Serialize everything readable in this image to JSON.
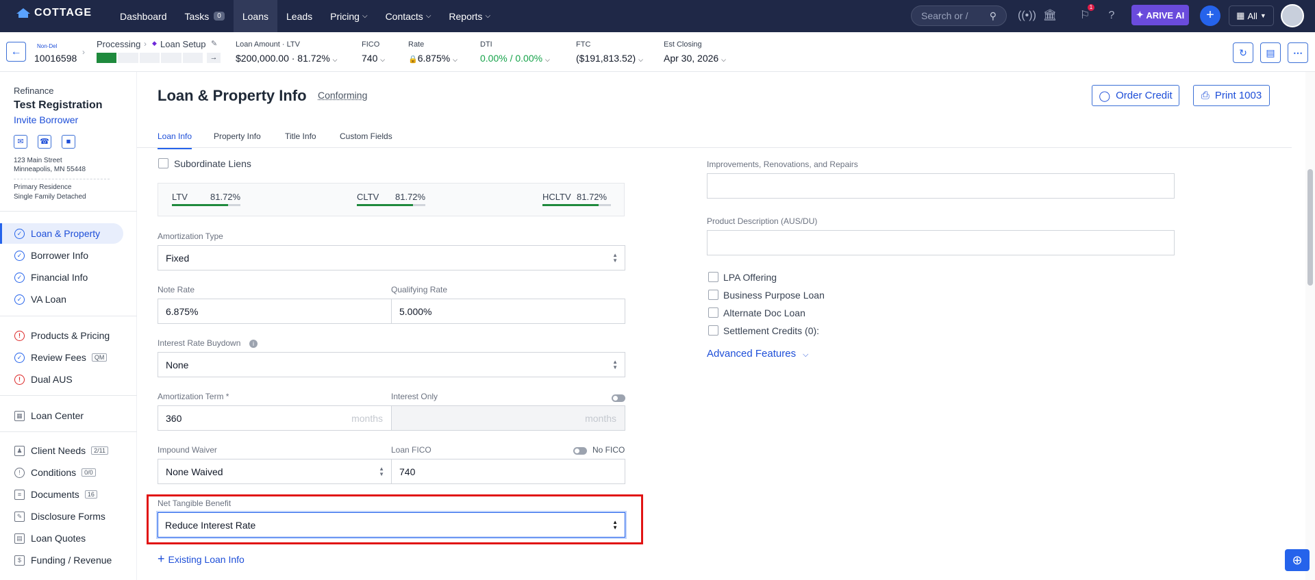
{
  "brand": "COTTAGE",
  "nav": {
    "items": [
      {
        "label": "Dashboard"
      },
      {
        "label": "Tasks",
        "badge": "0"
      },
      {
        "label": "Loans",
        "active": true
      },
      {
        "label": "Leads"
      },
      {
        "label": "Pricing",
        "dropdown": true
      },
      {
        "label": "Contacts",
        "dropdown": true
      },
      {
        "label": "Reports",
        "dropdown": true
      }
    ],
    "search_placeholder": "Search or /",
    "notif_count": "1",
    "arive_label": "ARIVE AI",
    "all_label": "All"
  },
  "status": {
    "tag": "Non-Del",
    "loan_number": "10016598",
    "stage": "Processing",
    "substage": "Loan Setup",
    "loan_amount_label": "Loan Amount · LTV",
    "loan_amount_value": "$200,000.00 · 81.72%",
    "fico_label": "FICO",
    "fico_value": "740",
    "rate_label": "Rate",
    "rate_value": "6.875%",
    "dti_label": "DTI",
    "dti_value": "0.00% / 0.00%",
    "ftc_label": "FTC",
    "ftc_value": "($191,813.52)",
    "closing_label": "Est Closing",
    "closing_value": "Apr 30, 2026",
    "progress_done_fraction": 0.2
  },
  "sidebar": {
    "type": "Refinance",
    "borrower": "Test Registration",
    "invite": "Invite Borrower",
    "address1": "123 Main Street",
    "address2": "Minneapolis, MN 55448",
    "occupancy": "Primary Residence",
    "property_type": "Single Family Detached",
    "items": [
      {
        "label": "Loan & Property",
        "icon": "check-icon",
        "active": true
      },
      {
        "label": "Borrower Info",
        "icon": "check-icon"
      },
      {
        "label": "Financial Info",
        "icon": "check-icon"
      },
      {
        "label": "VA Loan",
        "icon": "check-icon"
      },
      {
        "label": "Products & Pricing",
        "icon": "warning-icon"
      },
      {
        "label": "Review Fees",
        "icon": "check-icon",
        "tag": "QM"
      },
      {
        "label": "Dual AUS",
        "icon": "warning-icon"
      },
      {
        "label": "Loan Center",
        "icon": "building-icon"
      },
      {
        "label": "Client Needs",
        "icon": "person-icon",
        "tag": "2/11"
      },
      {
        "label": "Conditions",
        "icon": "alert-icon",
        "tag": "0/0"
      },
      {
        "label": "Documents",
        "icon": "document-icon",
        "tag": "16"
      },
      {
        "label": "Disclosure Forms",
        "icon": "pen-icon"
      },
      {
        "label": "Loan Quotes",
        "icon": "quote-icon"
      },
      {
        "label": "Funding / Revenue",
        "icon": "money-icon"
      }
    ]
  },
  "page": {
    "title": "Loan & Property Info",
    "subtitle": "Conforming",
    "order_credit": "Order Credit",
    "print": "Print 1003",
    "tabs": [
      "Loan Info",
      "Property Info",
      "Title Info",
      "Custom Fields"
    ]
  },
  "form": {
    "subordinate_liens": "Subordinate Liens",
    "ltv_label": "LTV",
    "ltv_value": "81.72%",
    "cltv_label": "CLTV",
    "cltv_value": "81.72%",
    "hcltv_label": "HCLTV",
    "hcltv_value": "81.72%",
    "amortization_type_label": "Amortization Type",
    "amortization_type_value": "Fixed",
    "note_rate_label": "Note Rate",
    "note_rate_value": "6.875%",
    "qualifying_rate_label": "Qualifying Rate",
    "qualifying_rate_value": "5.000%",
    "buydown_label": "Interest Rate Buydown",
    "buydown_value": "None",
    "amort_term_label": "Amortization Term *",
    "amort_term_value": "360",
    "months": "months",
    "interest_only_label": "Interest Only",
    "impound_label": "Impound Waiver",
    "impound_value": "None Waived",
    "loan_fico_label": "Loan FICO",
    "loan_fico_value": "740",
    "no_fico_label": "No FICO",
    "ntb_label": "Net Tangible Benefit",
    "ntb_value": "Reduce Interest Rate",
    "existing_loan": "Existing Loan Info",
    "improvements_label": "Improvements, Renovations, and Repairs",
    "product_desc_label": "Product Description (AUS/DU)",
    "lpa": "LPA Offering",
    "business": "Business Purpose Loan",
    "alt_doc": "Alternate Doc Loan",
    "settlement": "Settlement Credits (0):",
    "advanced": "Advanced Features"
  }
}
